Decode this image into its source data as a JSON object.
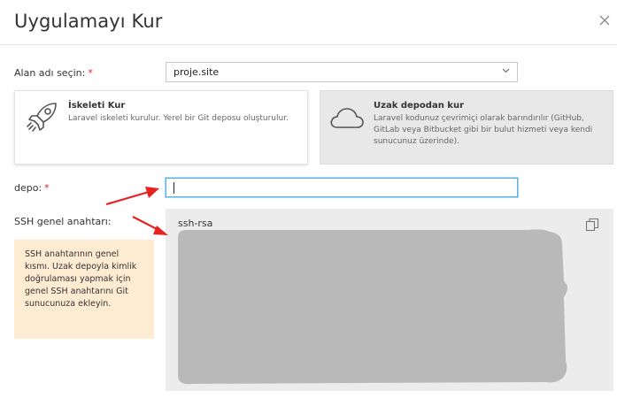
{
  "dialog": {
    "title": "Uygulamayı Kur",
    "close_icon": "close-icon"
  },
  "domain_field": {
    "label": "Alan adı seçin:",
    "required_mark": "*",
    "selected_value": "proje.site"
  },
  "options": {
    "scaffold": {
      "title": "İskeleti Kur",
      "description": "Laravel iskeleti kurulur. Yerel bir Git deposu oluşturulur.",
      "icon": "rocket-icon"
    },
    "remote": {
      "title": "Uzak depodan kur",
      "description": "Laravel kodunuz çevrimiçi olarak barındırılır (GitHub, GitLab veya Bitbucket gibi bir bulut hizmeti veya kendi sunucunuz üzerinde).",
      "icon": "cloud-icon",
      "selected": true
    }
  },
  "repo_field": {
    "label": "depo:",
    "required_mark": "*",
    "value": ""
  },
  "ssh_field": {
    "label": "SSH genel anahtarı:",
    "key_prefix": "ssh-rsa",
    "copy_icon": "copy-icon",
    "hint": "SSH anahtarının genel kısmı. Uzak depoyla kimlik doğrulaması yapmak için genel SSH anahtarını Git sunucunuza ekleyin."
  },
  "colors": {
    "required": "#e02020",
    "input_focus": "#5ab0de",
    "hint_background": "#fdebd2",
    "annotation_arrow": "#e8231f",
    "redaction": "#b9b9b9"
  }
}
